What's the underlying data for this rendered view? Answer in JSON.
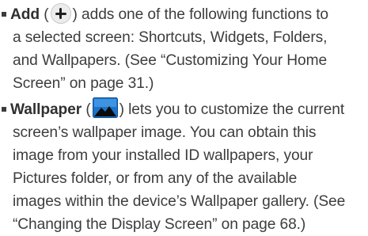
{
  "items": [
    {
      "term": "Add",
      "icon": "plus-circle-icon",
      "lines": [
        ") adds one of the following functions to",
        "a selected screen: Shortcuts, Widgets, Folders,",
        "and Wallpapers. (See “Customizing Your Home",
        "Screen” on page 31.)"
      ]
    },
    {
      "term": "Wallpaper",
      "icon": "wallpaper-landscape-icon",
      "lines": [
        ") lets you to customize the current",
        "screen’s wallpaper image. You can obtain this",
        "image from your installed ID wallpapers, your",
        "Pictures folder, or from any of the available",
        "images within the device’s Wallpaper gallery. (See",
        "“Changing the Display Screen” on page 68.)"
      ]
    }
  ],
  "open_paren": "("
}
